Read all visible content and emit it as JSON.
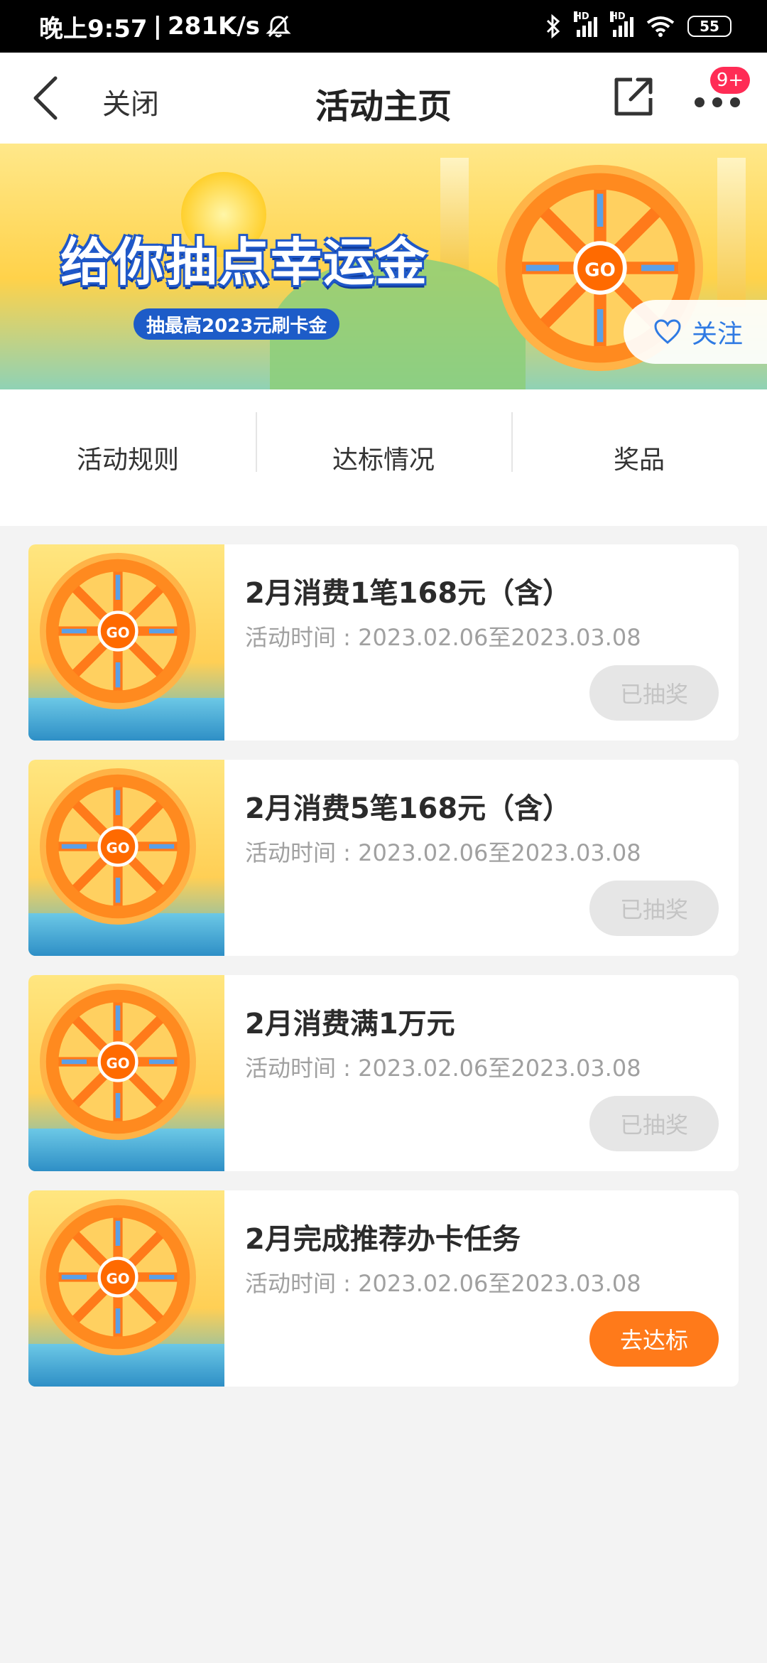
{
  "status_bar": {
    "time": "晚上9:57",
    "network_speed": "281K/s",
    "battery": "55"
  },
  "header": {
    "close_label": "关闭",
    "title": "活动主页",
    "badge": "9+"
  },
  "banner": {
    "headline": "给你抽点幸运金",
    "subline": "抽最高2023元刷卡金",
    "wheel_label": "GO",
    "follow_label": "关注"
  },
  "tabs": [
    {
      "label": "活动规则"
    },
    {
      "label": "达标情况"
    },
    {
      "label": "奖品"
    }
  ],
  "activities": [
    {
      "title": "2月消费1笔168元（含）",
      "time": "活动时间 : 2023.02.06至2023.03.08",
      "button": "已抽奖",
      "state": "done"
    },
    {
      "title": "2月消费5笔168元（含）",
      "time": "活动时间 : 2023.02.06至2023.03.08",
      "button": "已抽奖",
      "state": "done"
    },
    {
      "title": "2月消费满1万元",
      "time": "活动时间 : 2023.02.06至2023.03.08",
      "button": "已抽奖",
      "state": "done"
    },
    {
      "title": "2月完成推荐办卡任务",
      "time": "活动时间 : 2023.02.06至2023.03.08",
      "button": "去达标",
      "state": "go"
    }
  ],
  "colors": {
    "accent": "#ff7a1a",
    "badge": "#ff2c55",
    "follow_blue": "#2f7ae3",
    "disabled_bg": "#e6e6e6"
  }
}
